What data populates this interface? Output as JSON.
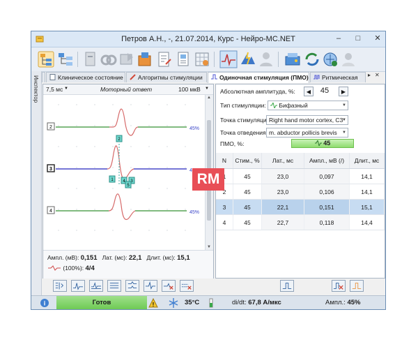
{
  "window": {
    "title": "Петров А.Н., -, 21.07.2014, Курс - Нейро-МС.NET",
    "minimize": "–",
    "maximize": "□",
    "close": "✕"
  },
  "inspector": {
    "label": "Инспектор"
  },
  "tabs": [
    {
      "label": "Клиническое состояние"
    },
    {
      "label": "Алгоритмы стимуляции"
    },
    {
      "label": "Одиночная стимуляция (ПМО)"
    },
    {
      "label": "Ритмическая"
    }
  ],
  "tab_nav": {
    "prev": "◂",
    "next": "▸",
    "close": "✕"
  },
  "plot_header": {
    "sweep": "7,5 мс",
    "mode": "Моторный ответ",
    "sensitivity": "100 мкВ"
  },
  "traces": [
    {
      "label": "2",
      "percent": "45%",
      "color": "#3aa84a"
    },
    {
      "label": "3",
      "percent": "45%",
      "color": "#4d55d6"
    },
    {
      "label": "4",
      "percent": "45%",
      "color": "#4d55d6"
    }
  ],
  "markers": [
    "2",
    "1",
    "4",
    "3",
    "5"
  ],
  "plot_footer": {
    "amp_label": "Ампл. (мВ):",
    "amp_value": "0,151",
    "lat_label": "Лат. (мс):",
    "lat_value": "22,1",
    "dur_label": "Длит. (мс):",
    "dur_value": "15,1",
    "count_label": "(100%):",
    "count_value": "4/4"
  },
  "settings": {
    "amplitude_label": "Абсолютная амплитуда, %:",
    "amplitude_value": "45",
    "stim_type_label": "Тип стимуляции:",
    "stim_type_value": "Бифазный",
    "stim_point_label": "Точка стимуляции:",
    "stim_point_value": "Right hand motor cortex, C3",
    "lead_point_label": "Точка отведения:",
    "lead_point_value": "m. abductor pollicis brevis",
    "pmo_label": "ПМО, %:",
    "pmo_value": "45"
  },
  "table": {
    "headers": [
      "N",
      "Стим., %",
      "Лат., мс",
      "Ампл., мВ (/)",
      "Длит., мс"
    ],
    "rows": [
      [
        "1",
        "45",
        "23,0",
        "0,097",
        "14,1"
      ],
      [
        "2",
        "45",
        "23,0",
        "0,106",
        "14,1"
      ],
      [
        "3",
        "45",
        "22,1",
        "0,151",
        "15,1"
      ],
      [
        "4",
        "45",
        "22,7",
        "0,118",
        "14,4"
      ]
    ],
    "selected_row": 2
  },
  "statusbar": {
    "ready": "Готов",
    "temperature": "35°C",
    "didt_label": "di/dt:",
    "didt_value": "67,8 А/мкс",
    "amp_label": "Ампл.:",
    "amp_value": "45%"
  },
  "watermark": "RM",
  "colors": {
    "accent": "#4d55d6",
    "green": "#3aa84a",
    "red": "#e0505a",
    "ready": "#7ed163"
  }
}
